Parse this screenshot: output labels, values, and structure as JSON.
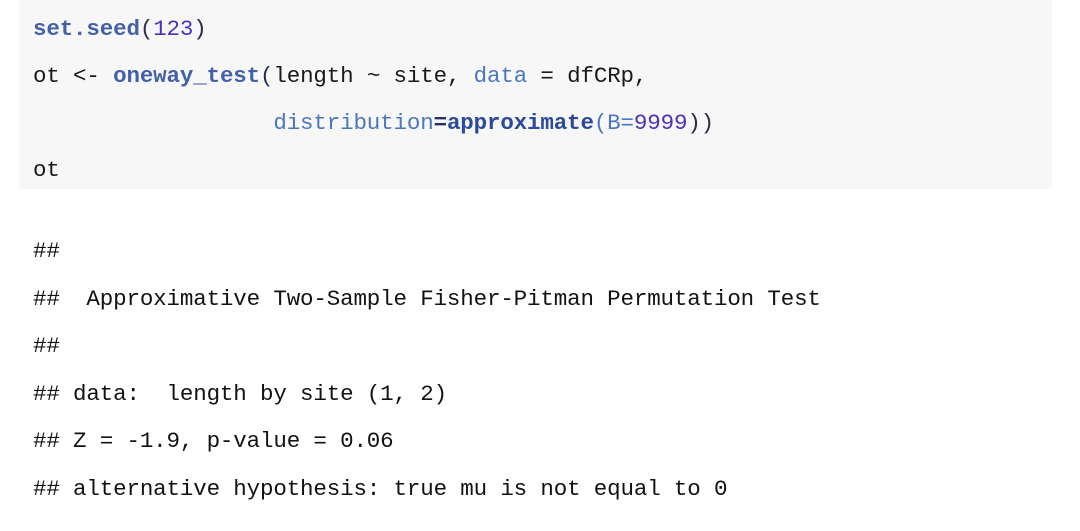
{
  "theme": {
    "page_background": "#ffffff",
    "code_background": "#f7f7f7",
    "text_color": "#121212",
    "function_color": "#4361a8",
    "number_color": "#4b2fc0",
    "argument_color": "#4b77be"
  },
  "code_chunk": {
    "language": "r",
    "line1": {
      "fn": "set.seed",
      "open_paren": "(",
      "arg": "123",
      "close_paren": ")"
    },
    "line2": {
      "assign": "ot <- ",
      "fn": "oneway_test",
      "open_paren": "(",
      "formula": "length ~ site, ",
      "arg_name": "data",
      "eq": " = ",
      "arg_value": "dfCRp,"
    },
    "line3": {
      "indent": "                  ",
      "arg_name": "distribution",
      "eq": "=",
      "fn": "approximate",
      "open_paren": "(",
      "inner_arg": "B=",
      "number": "9999",
      "close": "))"
    },
    "line4": {
      "text": "ot"
    },
    "full_text": "set.seed(123)\not <- oneway_test(length ~ site, data = dfCRp,\n                  distribution=approximate(B=9999))\not"
  },
  "console_output": {
    "lines": [
      "##",
      "##  Approximative Two-Sample Fisher-Pitman Permutation Test",
      "##",
      "## data:  length by site (1, 2)",
      "## Z = -1.9, p-value = 0.06",
      "## alternative hypothesis: true mu is not equal to 0"
    ],
    "test_name": "Approximative Two-Sample Fisher-Pitman Permutation Test",
    "data_description": "length by site (1, 2)",
    "z_statistic": "-1.9",
    "p_value": "0.06",
    "alternative_hypothesis": "true mu is not equal to 0"
  }
}
